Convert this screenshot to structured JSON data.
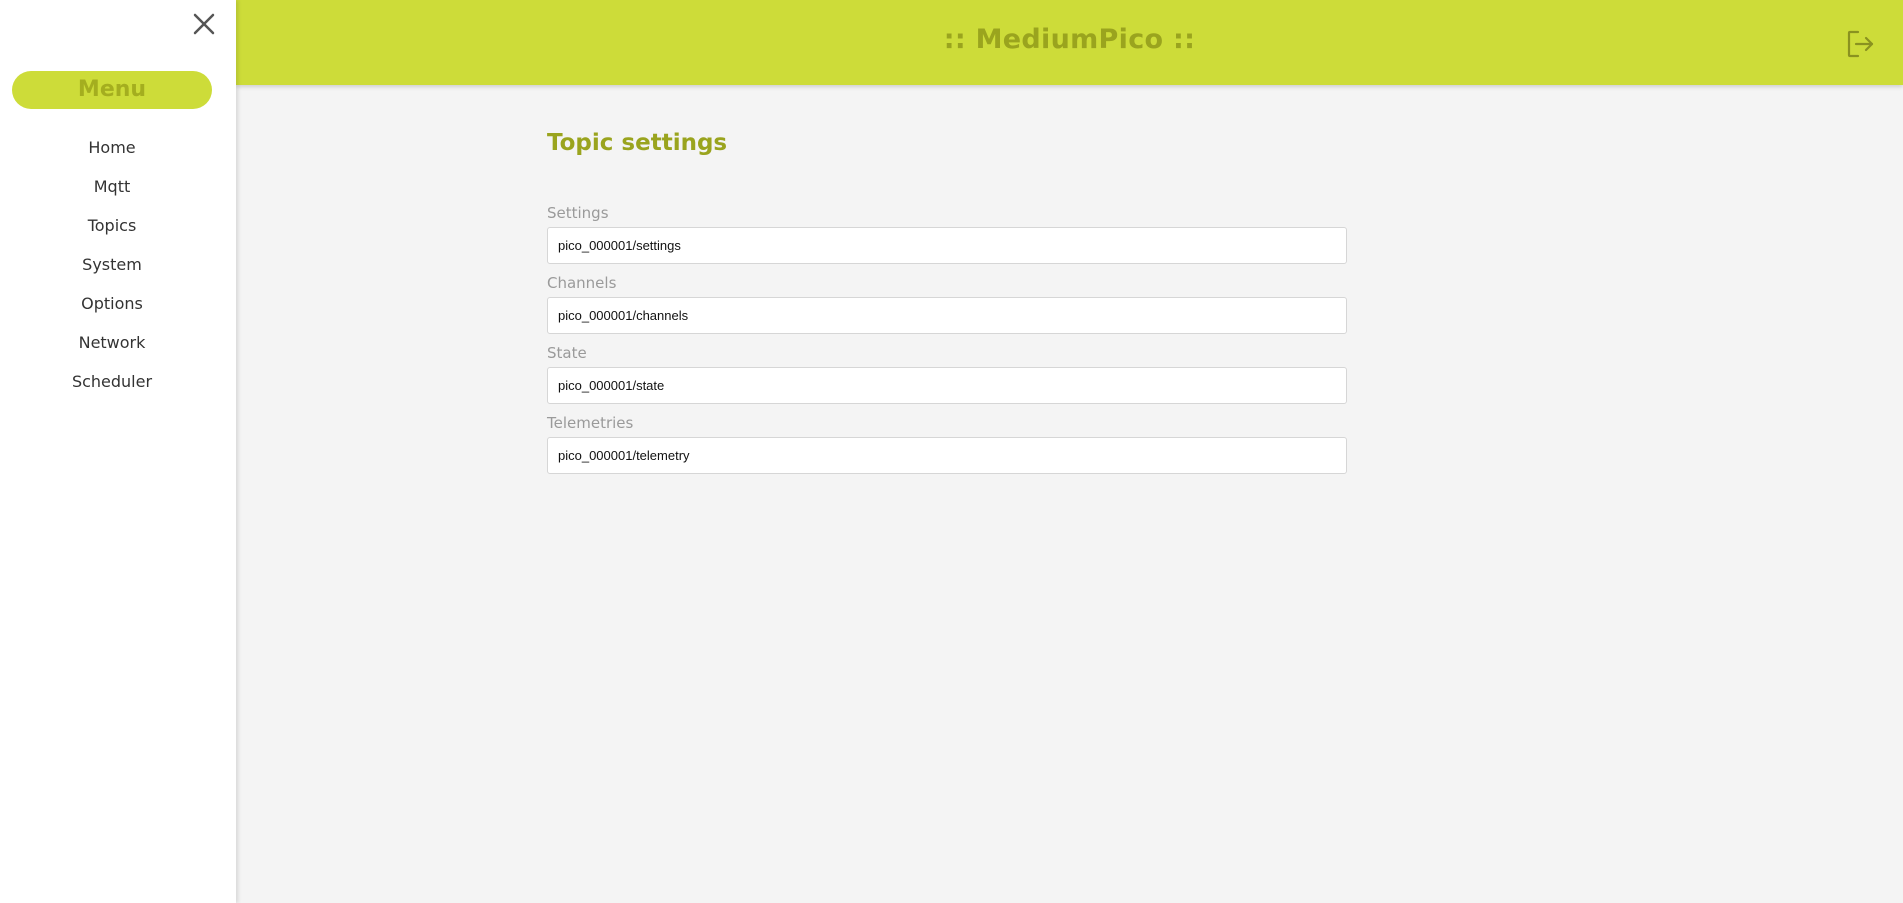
{
  "app": {
    "title": ":: MediumPico ::"
  },
  "sidebar": {
    "menu_label": "Menu",
    "close_icon": "close-icon",
    "items": [
      {
        "label": "Home"
      },
      {
        "label": "Mqtt"
      },
      {
        "label": "Topics"
      },
      {
        "label": "System"
      },
      {
        "label": "Options"
      },
      {
        "label": "Network"
      },
      {
        "label": "Scheduler"
      }
    ]
  },
  "header": {
    "logout_icon": "logout-icon"
  },
  "main": {
    "page_title": "Topic settings",
    "fields": [
      {
        "label": "Settings",
        "value": "pico_000001/settings"
      },
      {
        "label": "Channels",
        "value": "pico_000001/channels"
      },
      {
        "label": "State",
        "value": "pico_000001/state"
      },
      {
        "label": "Telemetries",
        "value": "pico_000001/telemetry"
      }
    ]
  },
  "colors": {
    "accent": "#cddc39",
    "accent_text": "#9aa41e",
    "background": "#f4f4f4"
  }
}
